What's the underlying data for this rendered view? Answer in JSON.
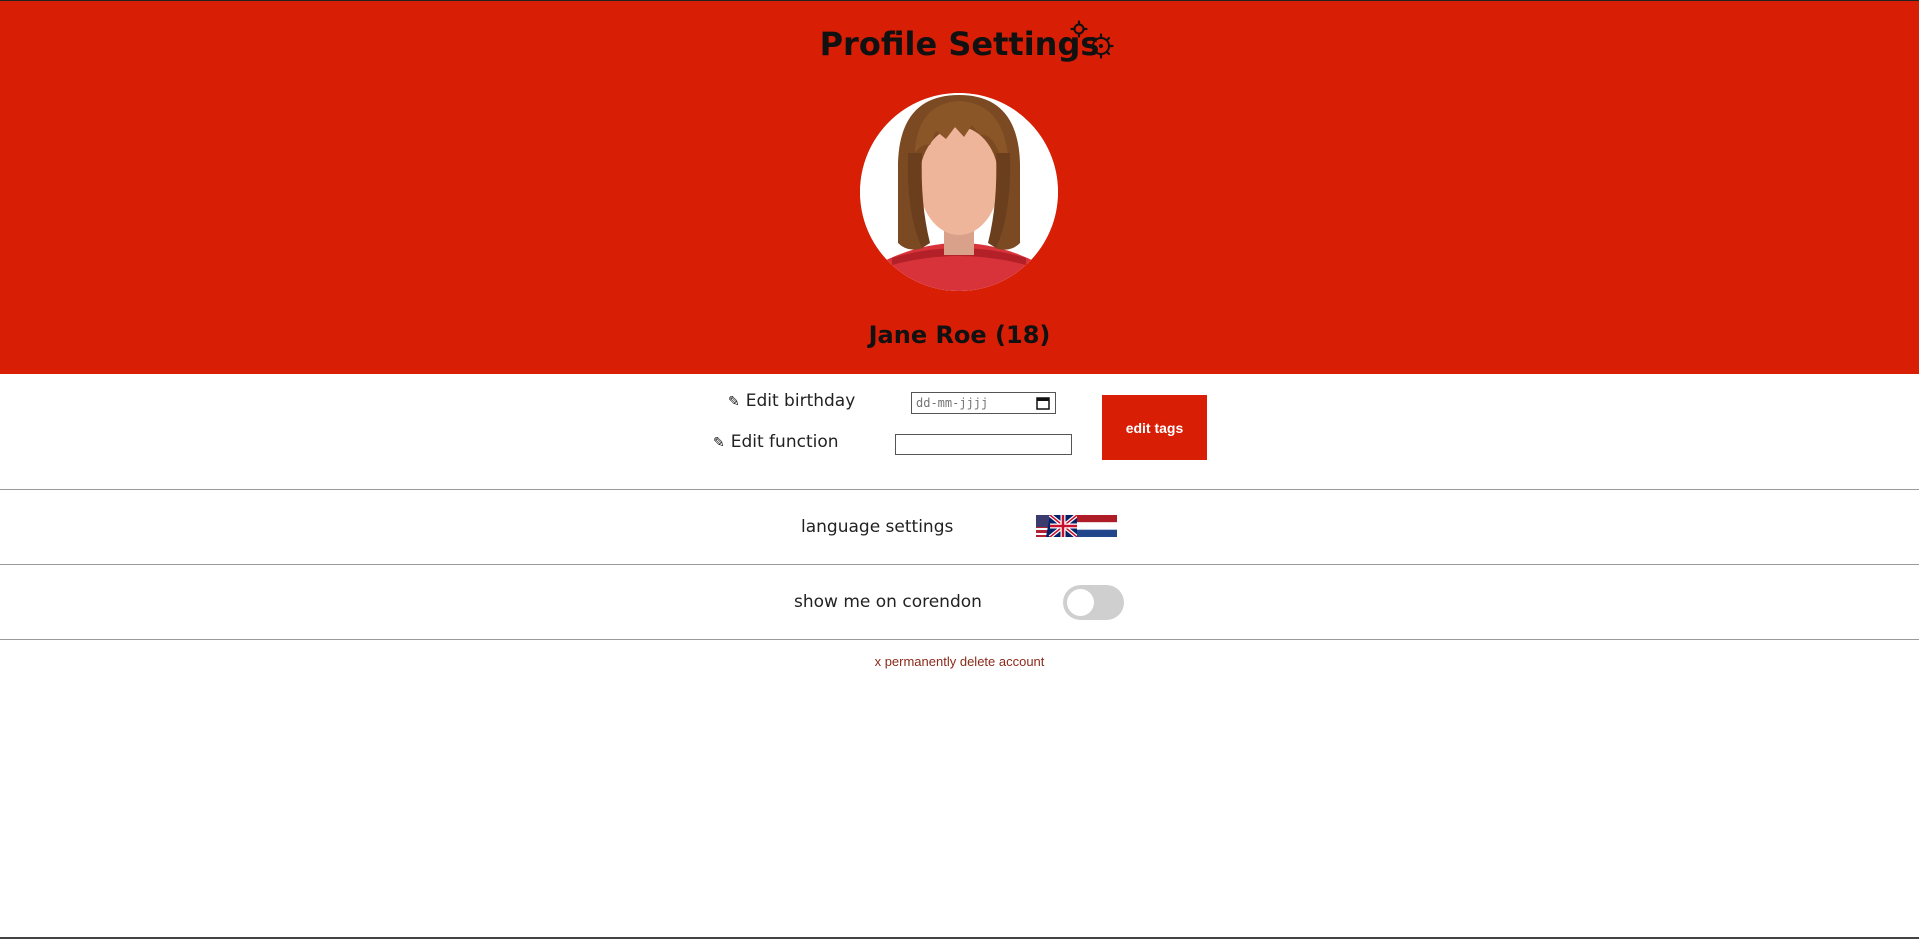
{
  "header": {
    "title": "Profile Settings",
    "settings_icon": "gears-icon",
    "background_color": "#d81e05"
  },
  "profile": {
    "avatar_icon": "female-avatar-icon",
    "name": "Jane Roe (18)"
  },
  "edit": {
    "birthday_label": "Edit birthday",
    "birthday_placeholder": "dd-mm-jjjj",
    "function_label": "Edit function",
    "function_value": "",
    "tags_button": "edit tags",
    "pencil_icon": "pencil-icon"
  },
  "language": {
    "label": "language settings",
    "flags": [
      "uk-us-flag-icon",
      "netherlands-flag-icon"
    ]
  },
  "visibility": {
    "label": "show me on corendon",
    "enabled": false
  },
  "danger": {
    "delete_label": "x permanently delete account"
  }
}
